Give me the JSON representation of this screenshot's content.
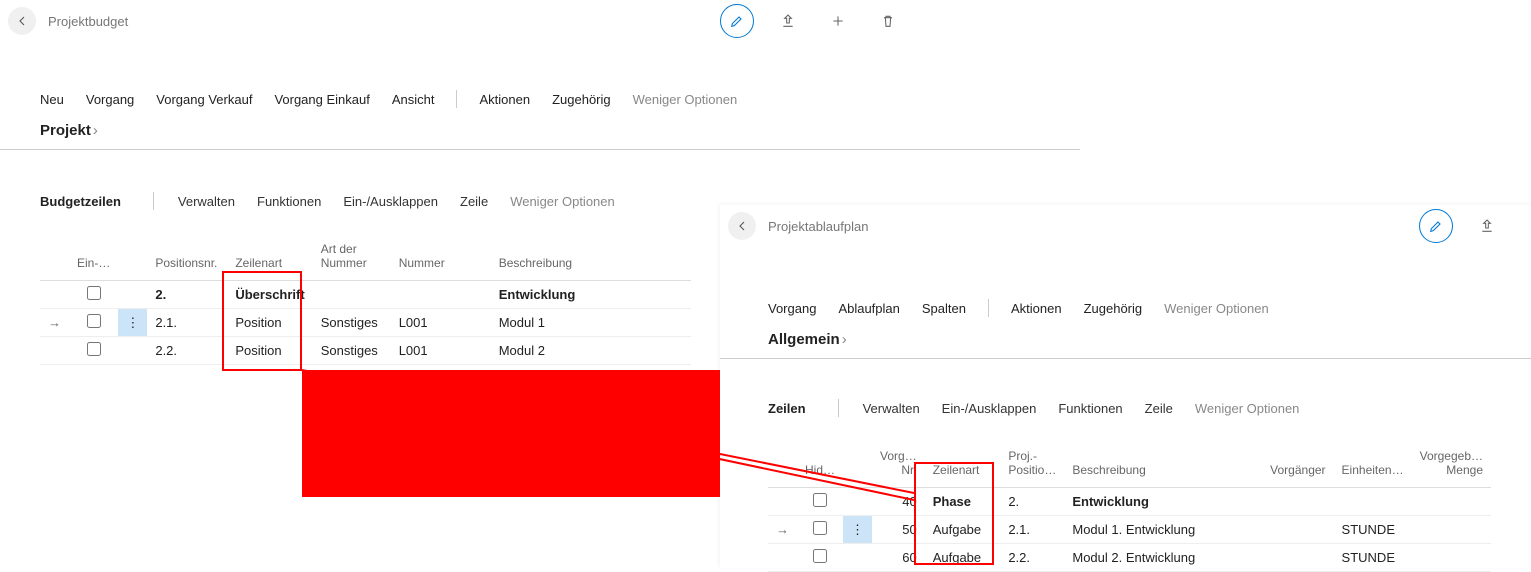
{
  "left": {
    "title": "Projektbudget",
    "menu": {
      "neu": "Neu",
      "vorgang": "Vorgang",
      "vorgang_verkauf": "Vorgang Verkauf",
      "vorgang_einkauf": "Vorgang Einkauf",
      "ansicht": "Ansicht",
      "aktionen": "Aktionen",
      "zugehoerig": "Zugehörig",
      "weniger": "Weniger Optionen"
    },
    "section_header": "Projekt",
    "sub_toolbar": {
      "lead": "Budgetzeilen",
      "verwalten": "Verwalten",
      "funktionen": "Funktionen",
      "einaus": "Ein-/Ausklappen",
      "zeile": "Zeile",
      "weniger": "Weniger Optionen"
    },
    "columns": {
      "ein": "Ein-…",
      "positionsnr": "Positionsnr.",
      "zeilenart": "Zeilenart",
      "art_der_nummer": "Art der\nNummer",
      "nummer": "Nummer",
      "beschreibung": "Beschreibung"
    },
    "rows": [
      {
        "arrow": "",
        "positionsnr": "2.",
        "zeilenart": "Überschrift",
        "art": "",
        "nummer": "",
        "beschreibung": "Entwicklung",
        "bold": true
      },
      {
        "arrow": "→",
        "positionsnr": "2.1.",
        "zeilenart": "Position",
        "art": "Sonstiges",
        "nummer": "L001",
        "beschreibung": "Modul 1",
        "selected": true
      },
      {
        "arrow": "",
        "positionsnr": "2.2.",
        "zeilenart": "Position",
        "art": "Sonstiges",
        "nummer": "L001",
        "beschreibung": "Modul 2"
      }
    ]
  },
  "right": {
    "title": "Projektablaufplan",
    "menu": {
      "vorgang": "Vorgang",
      "ablaufplan": "Ablaufplan",
      "spalten": "Spalten",
      "aktionen": "Aktionen",
      "zugehoerig": "Zugehörig",
      "weniger": "Weniger Optionen"
    },
    "section_header": "Allgemein",
    "sub_toolbar": {
      "lead": "Zeilen",
      "verwalten": "Verwalten",
      "einaus": "Ein-/Ausklappen",
      "funktionen": "Funktionen",
      "zeile": "Zeile",
      "weniger": "Weniger Optionen"
    },
    "columns": {
      "hid": "Hid…",
      "vorg_nr": "Vorg…\nNr.",
      "zeilenart": "Zeilenart",
      "proj_positio": "Proj.-\nPositio…",
      "beschreibung": "Beschreibung",
      "vorgaenger": "Vorgänger",
      "einheiten": "Einheiten…",
      "vorgegeb_menge": "Vorgegeb…\nMenge"
    },
    "rows": [
      {
        "arrow": "",
        "nr": "40",
        "zeilenart": "Phase",
        "proj": "2.",
        "beschreibung": "Entwicklung",
        "einheit": "",
        "bold": true
      },
      {
        "arrow": "→",
        "nr": "50",
        "zeilenart": "Aufgabe",
        "proj": "2.1.",
        "beschreibung": "Modul 1. Entwicklung",
        "einheit": "STUNDE",
        "selected": true
      },
      {
        "arrow": "",
        "nr": "60",
        "zeilenart": "Aufgabe",
        "proj": "2.2.",
        "beschreibung": "Modul 2. Entwicklung",
        "einheit": "STUNDE"
      }
    ]
  }
}
